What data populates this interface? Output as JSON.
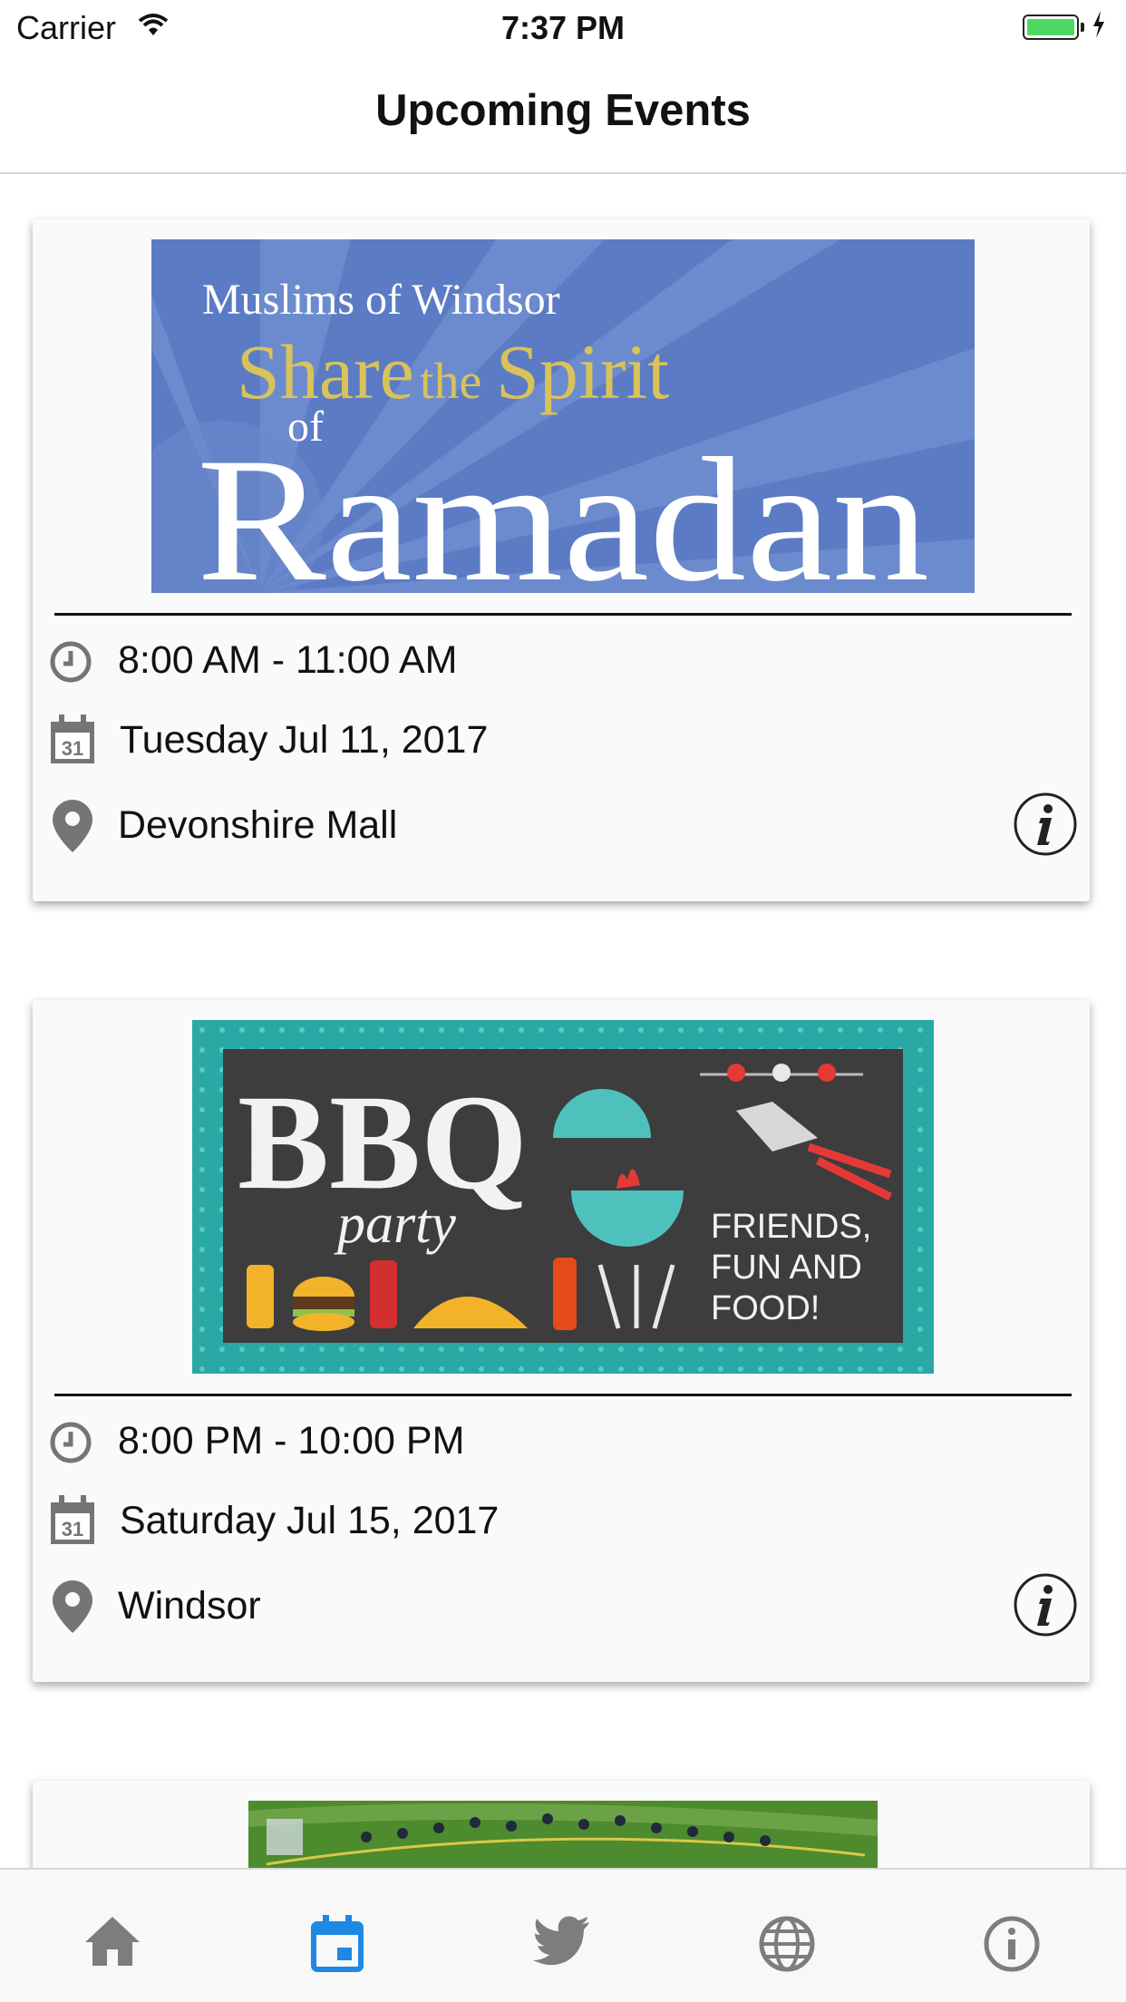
{
  "status_bar": {
    "carrier": "Carrier",
    "time": "7:37 PM",
    "battery_level": 1.0
  },
  "header": {
    "title": "Upcoming Events"
  },
  "events": [
    {
      "image": {
        "line1": "Muslims of Windsor",
        "line2_a": "Share",
        "line2_b": "the",
        "line2_c": "Spirit",
        "line3": "of",
        "line4": "Ramadan"
      },
      "time": "8:00 AM - 11:00 AM",
      "date": "Tuesday Jul 11, 2017",
      "location": "Devonshire Mall"
    },
    {
      "image": {
        "title": "BBQ",
        "subtitle": "party",
        "tagline1": "FRIENDS,",
        "tagline2": "FUN AND",
        "tagline3": "FOOD!"
      },
      "time": "8:00 PM - 10:00 PM",
      "date": "Saturday Jul 15, 2017",
      "location": "Windsor"
    },
    {
      "image": {}
    }
  ],
  "calendar_icon_day": "31",
  "tabs": [
    {
      "icon": "home-icon",
      "active": false
    },
    {
      "icon": "calendar-icon",
      "active": true
    },
    {
      "icon": "twitter-icon",
      "active": false
    },
    {
      "icon": "globe-icon",
      "active": false
    },
    {
      "icon": "info-icon",
      "active": false
    }
  ],
  "colors": {
    "tab_active": "#1e88e5",
    "tab_inactive": "#7d7d7d",
    "icon_gray": "#757575",
    "ramadan_bg": "#5b7bc4",
    "ramadan_gold": "#d9c25a",
    "bbq_teal": "#29a8a5",
    "bbq_chalk": "#3d3d3d"
  }
}
